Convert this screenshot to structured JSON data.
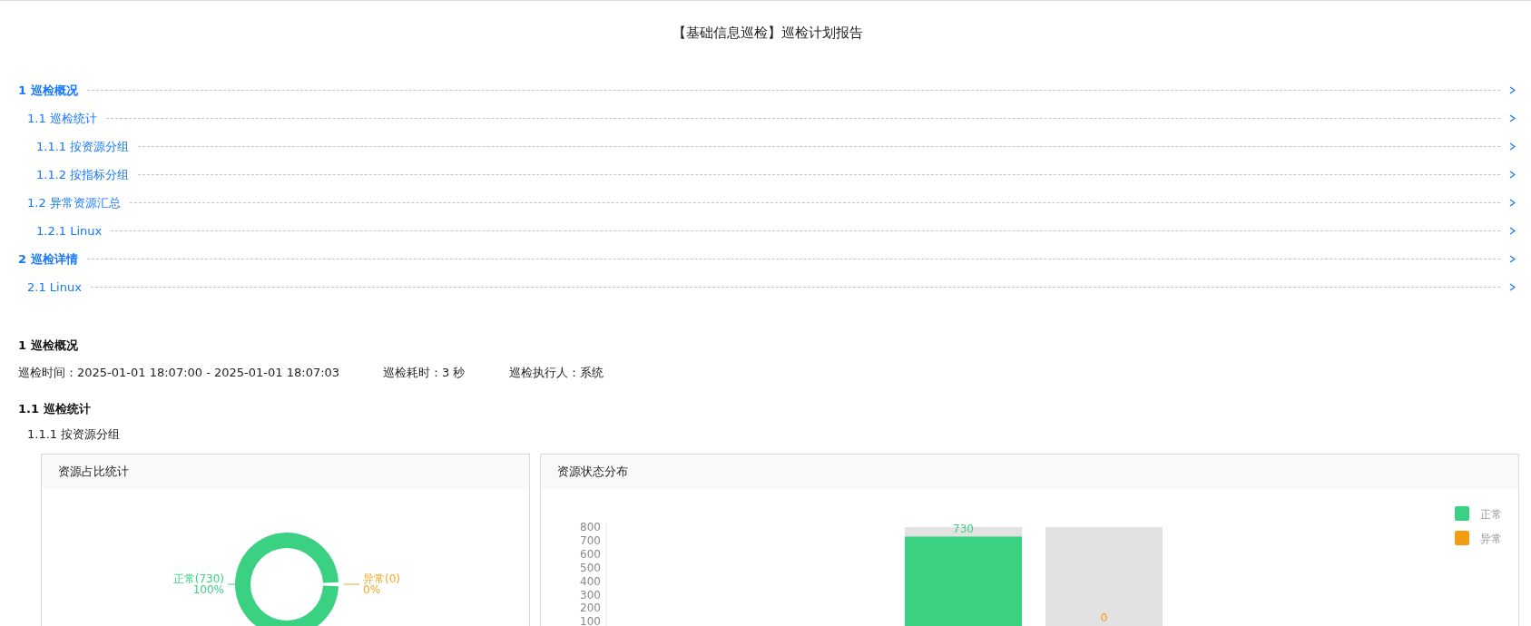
{
  "title": "【基础信息巡检】巡检计划报告",
  "toc": [
    {
      "label": "1 巡检概况",
      "children": [
        {
          "label": "1.1 巡检统计",
          "children": [
            {
              "label": "1.1.1 按资源分组"
            },
            {
              "label": "1.1.2 按指标分组"
            }
          ]
        },
        {
          "label": "1.2 异常资源汇总",
          "children": [
            {
              "label": "1.2.1 Linux"
            }
          ]
        }
      ]
    },
    {
      "label": "2 巡检详情",
      "children": [
        {
          "label": "2.1 Linux"
        }
      ]
    }
  ],
  "section": {
    "heading": "1 巡检概况",
    "meta": [
      "巡检时间：2025-01-01 18:07:00 - 2025-01-01 18:07:03",
      "巡检耗时：3 秒",
      "巡检执行人：系统"
    ],
    "subheading": "1.1 巡检统计",
    "subsubheading": "1.1.1 按资源分组"
  },
  "cards": [
    {
      "title": "资源占比统计",
      "kind": "ring",
      "slices": [
        {
          "label": "正常(730)",
          "percent": "100%",
          "color": "#3ad183"
        },
        {
          "label": "异常(0)",
          "percent": "0%",
          "color": "#f5a623"
        }
      ]
    },
    {
      "title": "资源状态分布",
      "kind": "bars",
      "y_labels": [
        "800",
        "700",
        "600",
        "500",
        "400",
        "300",
        "200",
        "100"
      ],
      "bars": [
        {
          "name": "正常",
          "color": "#3ad183",
          "value": "730"
        },
        {
          "name": "异常",
          "color": "#f39c12",
          "value": "0"
        }
      ]
    }
  ]
}
